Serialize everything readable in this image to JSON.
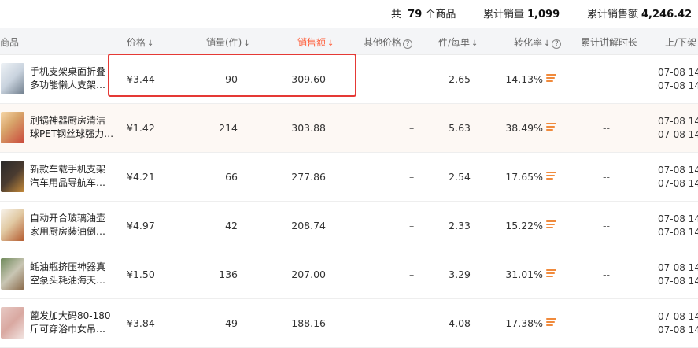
{
  "summary": {
    "count_prefix": "共",
    "count": "79",
    "count_suffix": "个商品",
    "sales_label": "累计销量",
    "sales_value": "1,099",
    "revenue_label": "累计销售额",
    "revenue_value": "4,246.42"
  },
  "columns": {
    "product": "商品",
    "price": "价格",
    "sales": "销量(件)",
    "revenue": "销售额",
    "other_price": "其他价格",
    "per_order": "件/每单",
    "conversion": "转化率",
    "duration": "累计讲解时长",
    "updown": "上/下架"
  },
  "icons": {
    "sort": "↓",
    "help": "?",
    "conversion_trend": "trend-bars-icon"
  },
  "colors": {
    "accent": "#ff5a35",
    "highlight_border": "#e53935",
    "trend_bar": "#f08a3c"
  },
  "rows": [
    {
      "name_l1": "手机支架桌面折叠",
      "name_l2": "多功能懒人支架…",
      "price": "¥3.44",
      "sales": "90",
      "revenue": "309.60",
      "other_price": "–",
      "per_order": "2.65",
      "conversion": "14.13%",
      "duration": "--",
      "time1": "07-08  14",
      "time2": "07-08  14"
    },
    {
      "name_l1": "刷锅神器厨房清洁",
      "name_l2": "球PET钢丝球强力…",
      "price": "¥1.42",
      "sales": "214",
      "revenue": "303.88",
      "other_price": "–",
      "per_order": "5.63",
      "conversion": "38.49%",
      "duration": "--",
      "time1": "07-08  14",
      "time2": "07-08  14"
    },
    {
      "name_l1": "新款车载手机支架",
      "name_l2": "汽车用品导航车…",
      "price": "¥4.21",
      "sales": "66",
      "revenue": "277.86",
      "other_price": "–",
      "per_order": "2.54",
      "conversion": "17.65%",
      "duration": "--",
      "time1": "07-08  14",
      "time2": "07-08  14"
    },
    {
      "name_l1": "自动开合玻璃油壶",
      "name_l2": "家用厨房装油倒…",
      "price": "¥4.97",
      "sales": "42",
      "revenue": "208.74",
      "other_price": "–",
      "per_order": "2.33",
      "conversion": "15.22%",
      "duration": "--",
      "time1": "07-08  14",
      "time2": "07-08  14"
    },
    {
      "name_l1": "蚝油瓶挤压神器真",
      "name_l2": "空泵头耗油海天…",
      "price": "¥1.50",
      "sales": "136",
      "revenue": "207.00",
      "other_price": "–",
      "per_order": "3.29",
      "conversion": "31.01%",
      "duration": "--",
      "time1": "07-08  14",
      "time2": "07-08  14"
    },
    {
      "name_l1": "蓖发加大码80-180",
      "name_l2": "斤可穿浴巾女吊…",
      "price": "¥3.84",
      "sales": "49",
      "revenue": "188.16",
      "other_price": "–",
      "per_order": "4.08",
      "conversion": "17.38%",
      "duration": "--",
      "time1": "07-08  14",
      "time2": "07-08  14"
    }
  ]
}
